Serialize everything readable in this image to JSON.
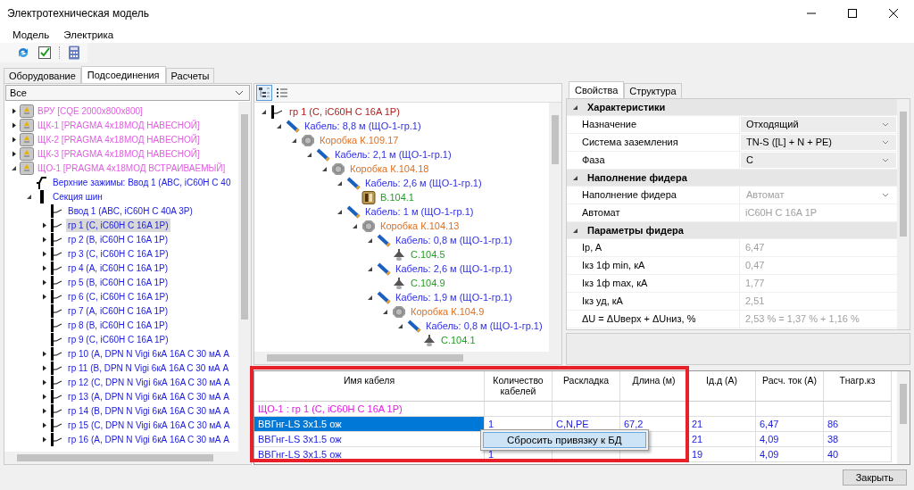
{
  "window": {
    "title": "Электротехническая модель"
  },
  "menu": [
    "Модель",
    "Электрика"
  ],
  "main_tabs": [
    {
      "label": "Оборудование",
      "selected": false
    },
    {
      "label": "Подсоединения",
      "selected": true
    },
    {
      "label": "Расчеты",
      "selected": false
    }
  ],
  "filter": {
    "value": "Все"
  },
  "left_tree": [
    {
      "label": "ВРУ [CQE 2000x800x800]",
      "kind": "panel",
      "expanded": false,
      "selected": false
    },
    {
      "label": "ЩК-1 [PRAGMA 4x18МОД НАВЕСНОЙ]",
      "kind": "panel",
      "expanded": false,
      "selected": false
    },
    {
      "label": "ЩК-2 [PRAGMA 4x18МОД НАВЕСНОЙ]",
      "kind": "panel",
      "expanded": false,
      "selected": false
    },
    {
      "label": "ЩК-3 [PRAGMA 4x18МОД НАВЕСНОЙ]",
      "kind": "panel",
      "expanded": false,
      "selected": false
    },
    {
      "label": "ЩО-1 [PRAGMA 4x18МОД ВСТРАИВАЕМЫЙ]",
      "kind": "panel",
      "expanded": true,
      "selected": false,
      "children": [
        {
          "label": "Верхние зажимы: Ввод 1 (ABC, iC60H C 40",
          "kind": "terminal",
          "selected": false
        },
        {
          "label": "Секция шин",
          "kind": "busbar",
          "expanded": true,
          "selected": false,
          "children": [
            {
              "label": "Ввод 1 (ABC, iC60H C 40A 3P)",
              "kind": "breaker",
              "selected": false
            },
            {
              "label": "гр 1 (C, iC60H C 16A 1P)",
              "kind": "breaker",
              "expanded": false,
              "selected": true
            },
            {
              "label": "гр 2 (B, iC60H C 16A 1P)",
              "kind": "breaker",
              "expanded": false,
              "selected": false
            },
            {
              "label": "гр 3 (C, iC60H C 16A 1P)",
              "kind": "breaker",
              "expanded": false,
              "selected": false
            },
            {
              "label": "гр 4 (A, iC60H C 16A 1P)",
              "kind": "breaker",
              "expanded": false,
              "selected": false
            },
            {
              "label": "гр 5 (B, iC60H C 16A 1P)",
              "kind": "breaker",
              "expanded": false,
              "selected": false
            },
            {
              "label": "гр 6 (C, iC60H C 16A 1P)",
              "kind": "breaker",
              "expanded": false,
              "selected": false
            },
            {
              "label": "гр 7 (A, iC60H C 16A 1P)",
              "kind": "breaker",
              "selected": false
            },
            {
              "label": "гр 8 (B, iC60H C 16A 1P)",
              "kind": "breaker",
              "selected": false
            },
            {
              "label": "гр 9 (C, iC60H C 16A 1P)",
              "kind": "breaker",
              "selected": false
            },
            {
              "label": "гр 10 (A, DPN N Vigi 6кА 16A C 30 мА А",
              "kind": "breaker",
              "expanded": false,
              "selected": false
            },
            {
              "label": "гр 11 (B, DPN N Vigi 6кА 16A C 30 мА А",
              "kind": "breaker",
              "expanded": false,
              "selected": false
            },
            {
              "label": "гр 12 (C, DPN N Vigi 6кА 16A C 30 мА А",
              "kind": "breaker",
              "expanded": false,
              "selected": false
            },
            {
              "label": "гр 13 (A, DPN N Vigi 6кА 16A C 30 мА А",
              "kind": "breaker",
              "expanded": false,
              "selected": false
            },
            {
              "label": "гр 14 (B, DPN N Vigi 6кА 16A C 30 мА А",
              "kind": "breaker",
              "expanded": false,
              "selected": false
            },
            {
              "label": "гр 15 (C, DPN N Vigi 6кА 16A C 30 мА А",
              "kind": "breaker",
              "expanded": false,
              "selected": false
            },
            {
              "label": "гр 16 (A, DPN N Vigi 6кА 16A C 30 мА А",
              "kind": "breaker",
              "expanded": false,
              "selected": false
            }
          ]
        }
      ]
    }
  ],
  "view_buttons": [
    {
      "kind": "tree",
      "selected": true
    },
    {
      "kind": "list",
      "selected": false
    }
  ],
  "connection_tree": [
    {
      "label": "гр 1 (C, iC60H C 16A 1P)",
      "kind": "breaker",
      "expanded": true,
      "children": [
        {
          "label": "Кабель: 8,8 м (ЩО-1-гр.1)",
          "kind": "cable",
          "expanded": true,
          "children": [
            {
              "label": "Коробка К.109.17",
              "kind": "box",
              "expanded": true,
              "children": [
                {
                  "label": "Кабель: 2,1 м (ЩО-1-гр.1)",
                  "kind": "cable",
                  "expanded": true,
                  "children": [
                    {
                      "label": "Коробка К.104.18",
                      "kind": "box",
                      "expanded": true,
                      "children": [
                        {
                          "label": "Кабель: 2,6 м (ЩО-1-гр.1)",
                          "kind": "cable",
                          "expanded": true,
                          "children": [
                            {
                              "label": "В.104.1",
                              "kind": "switch"
                            }
                          ]
                        },
                        {
                          "label": "Кабель: 1 м (ЩО-1-гр.1)",
                          "kind": "cable",
                          "expanded": true,
                          "children": [
                            {
                              "label": "Коробка К.104.13",
                              "kind": "box",
                              "expanded": true,
                              "children": [
                                {
                                  "label": "Кабель: 0,8 м (ЩО-1-гр.1)",
                                  "kind": "cable",
                                  "expanded": true,
                                  "children": [
                                    {
                                      "label": "С.104.5",
                                      "kind": "lamp"
                                    }
                                  ]
                                },
                                {
                                  "label": "Кабель: 2,6 м (ЩО-1-гр.1)",
                                  "kind": "cable",
                                  "expanded": true,
                                  "children": [
                                    {
                                      "label": "С.104.9",
                                      "kind": "lamp"
                                    }
                                  ]
                                },
                                {
                                  "label": "Кабель: 1,9 м (ЩО-1-гр.1)",
                                  "kind": "cable",
                                  "expanded": true,
                                  "children": [
                                    {
                                      "label": "Коробка К.104.9",
                                      "kind": "box",
                                      "expanded": true,
                                      "children": [
                                        {
                                          "label": "Кабель: 0,8 м (ЩО-1-гр.1)",
                                          "kind": "cable",
                                          "expanded": true,
                                          "children": [
                                            {
                                              "label": "С.104.1",
                                              "kind": "lamp"
                                            }
                                          ]
                                        }
                                      ]
                                    }
                                  ]
                                }
                              ]
                            }
                          ]
                        }
                      ]
                    }
                  ]
                }
              ]
            }
          ]
        }
      ]
    }
  ],
  "panel_tabs": [
    {
      "label": "Свойства",
      "selected": true
    },
    {
      "label": "Структура",
      "selected": false
    }
  ],
  "properties": [
    {
      "category": "Характеристики",
      "expanded": true,
      "rows": [
        {
          "label": "Назначение",
          "value": "Отходящий",
          "kind": "dropdown",
          "disabled": false
        },
        {
          "label": "Система заземления",
          "value": "TN-S ([L] + N + PE)",
          "kind": "dropdown",
          "disabled": false
        },
        {
          "label": "Фаза",
          "value": "C",
          "kind": "dropdown",
          "disabled": false
        }
      ]
    },
    {
      "category": "Наполнение фидера",
      "expanded": true,
      "rows": [
        {
          "label": "Наполнение фидера",
          "value": "Автомат",
          "kind": "dropdown",
          "disabled": true
        },
        {
          "label": "Автомат",
          "value": "iC60H C 16A 1P",
          "kind": "text",
          "disabled": true
        }
      ]
    },
    {
      "category": "Параметры фидера",
      "expanded": true,
      "rows": [
        {
          "label": "Ip, A",
          "value": "6,47",
          "kind": "text",
          "disabled": true
        },
        {
          "label": "Iкз 1ф min, кА",
          "value": "0,47",
          "kind": "text",
          "disabled": true
        },
        {
          "label": "Iкз 1ф max, кА",
          "value": "1,77",
          "kind": "text",
          "disabled": true
        },
        {
          "label": "Iкз уд, кА",
          "value": "2,51",
          "kind": "text",
          "disabled": true
        },
        {
          "label": "ΔU = ΔUверх + ΔUниз, %",
          "value": "2,53 % = 1,37 % + 1,16 %",
          "kind": "text",
          "disabled": true
        }
      ]
    }
  ],
  "cable_table": {
    "columns": [
      "Имя кабеля",
      "Количество кабелей",
      "Раскладка",
      "Длина (м)",
      "Iд.д (А)",
      "Расч. ток (А)",
      "Тнагр.кз"
    ],
    "rows": [
      {
        "kind": "group",
        "cells": [
          "ЩО-1 : гр 1 (C, iC60H C 16A 1P)"
        ],
        "selected": false
      },
      {
        "kind": "cable",
        "cells": [
          "ВВГнг-LS 3x1.5 ож",
          "1",
          "C,N,PE",
          "67,2",
          "21",
          "6,47",
          "86"
        ],
        "selected": true
      },
      {
        "kind": "cable",
        "cells": [
          "ВВГнг-LS 3x1.5 ож",
          "",
          "",
          "",
          "21",
          "4,09",
          "38"
        ],
        "selected": false
      },
      {
        "kind": "cable",
        "cells": [
          "ВВГнг-LS 3x1.5 ож",
          "1",
          "",
          "",
          "19",
          "4,09",
          "40"
        ],
        "selected": false
      }
    ]
  },
  "context_menu": {
    "items": [
      {
        "label": "Сбросить привязку к БД",
        "selected": true
      }
    ]
  },
  "highlight_frame": true,
  "buttons": [
    "Закрыть"
  ]
}
